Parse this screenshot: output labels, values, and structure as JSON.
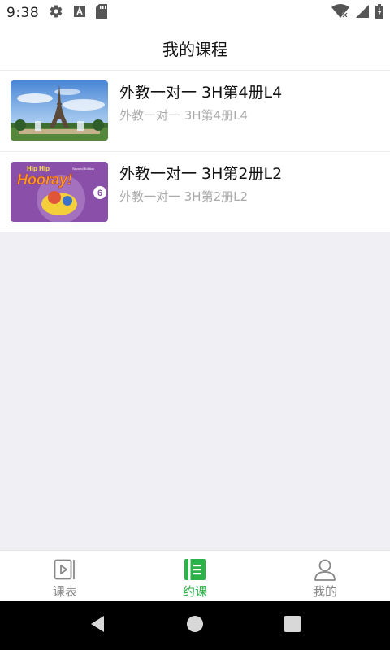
{
  "status_bar": {
    "time": "9:38",
    "icons": [
      "settings-icon",
      "font-a-icon",
      "sd-card-icon",
      "wifi-icon",
      "signal-icon",
      "battery-icon"
    ]
  },
  "header": {
    "title": "我的课程"
  },
  "courses": [
    {
      "title": "外教一对一 3H第4册L4",
      "subtitle": "外教一对一 3H第4册L4",
      "thumbnail": "eiffel-tower-photo"
    },
    {
      "title": "外教一对一 3H第2册L2",
      "subtitle": "外教一对一 3H第2册L2",
      "thumbnail": "hip-hip-hooray-book-cover",
      "cover_text": {
        "line1": "Hip Hip",
        "line2": "Hooray!",
        "edition": "Second Edition",
        "number": "6"
      }
    }
  ],
  "tabs": [
    {
      "label": "课表",
      "icon": "schedule-icon",
      "active": false
    },
    {
      "label": "约课",
      "icon": "book-icon",
      "active": true
    },
    {
      "label": "我的",
      "icon": "person-icon",
      "active": false
    }
  ],
  "colors": {
    "accent": "#2db24a",
    "inactive": "#888888",
    "background": "#efeff4"
  },
  "nav_bar": {
    "buttons": [
      "back-icon",
      "home-icon",
      "recents-icon"
    ]
  }
}
